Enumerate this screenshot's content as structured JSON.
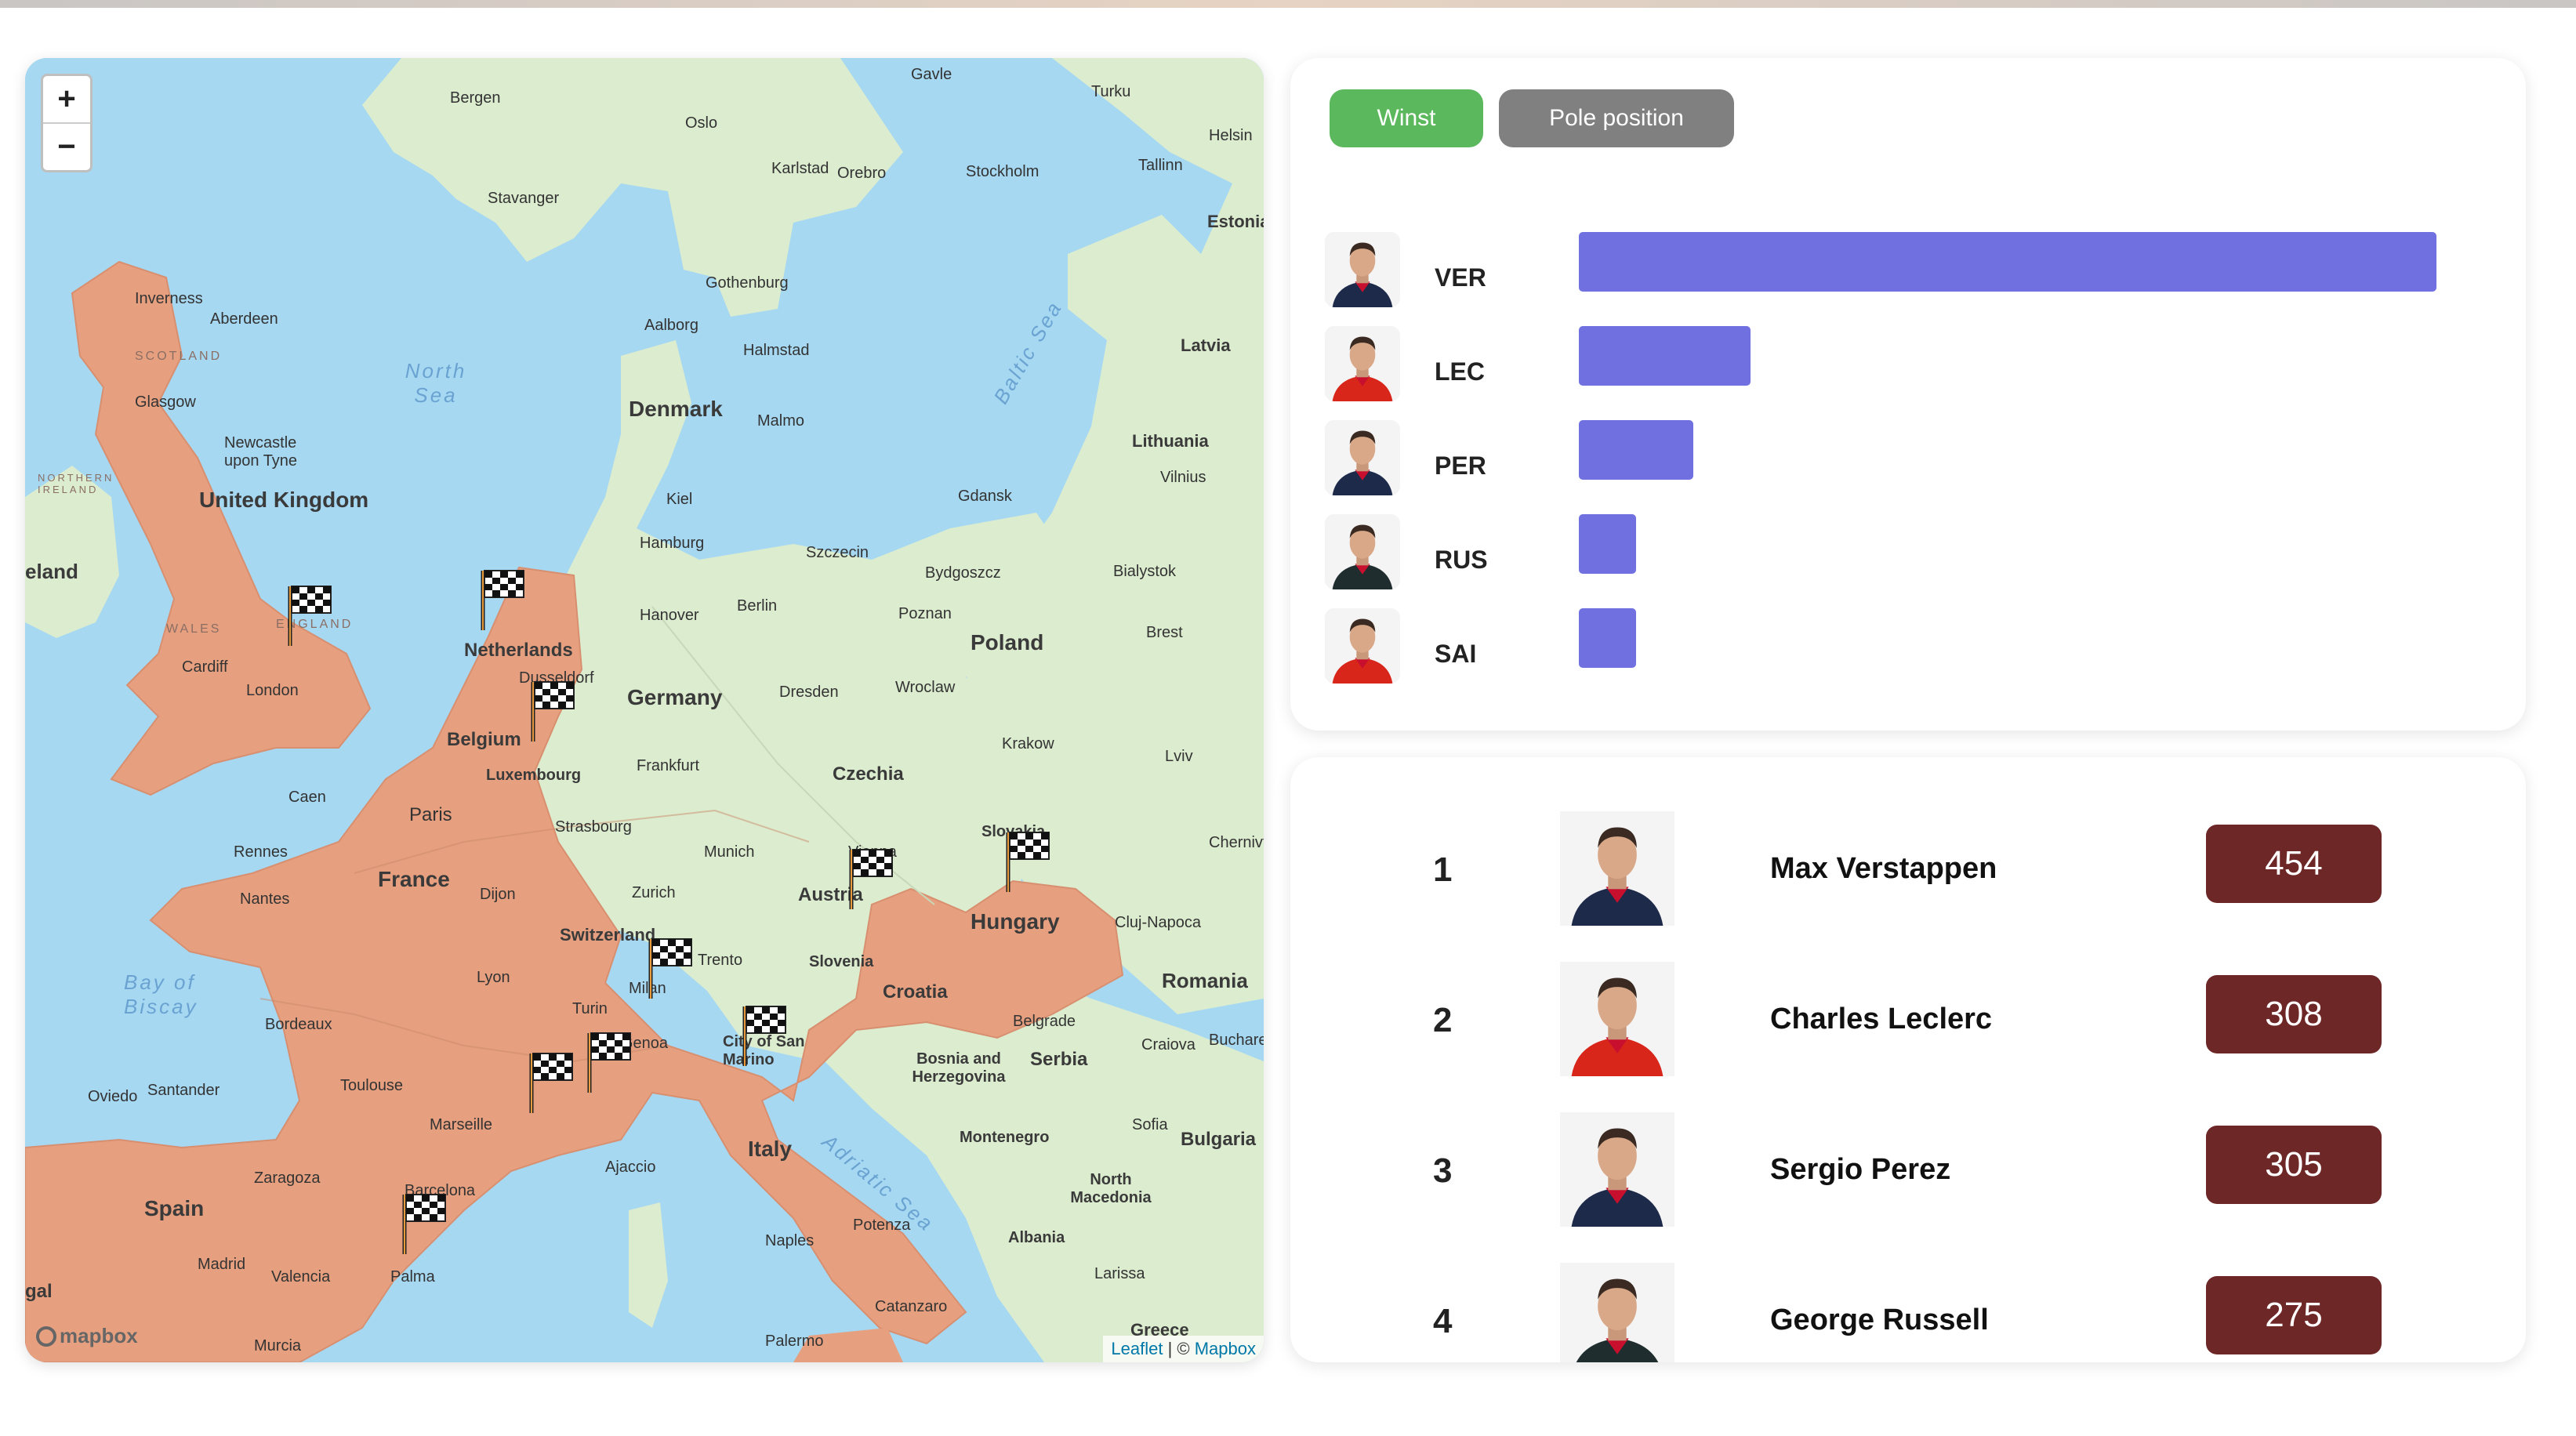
{
  "map": {
    "zoom_in": "+",
    "zoom_out": "−",
    "attribution": {
      "leaflet": "Leaflet",
      "separator": " | © ",
      "mapbox": "Mapbox"
    },
    "logo": "mapbox",
    "labels": {
      "countries": [
        "United Kingdom",
        "Netherlands",
        "Belgium",
        "Luxembourg",
        "France",
        "Germany",
        "Denmark",
        "Poland",
        "Czechia",
        "Austria",
        "Switzerland",
        "Hungary",
        "Slovakia",
        "Slovenia",
        "Croatia",
        "Italy",
        "Spain",
        "Romania",
        "Serbia",
        "Bulgaria",
        "Lithuania",
        "Latvia",
        "Estonia",
        "Bosnia and Herzegovina",
        "Montenegro",
        "North Macedonia",
        "Albania",
        "City of San Marino",
        "eland",
        "Greece",
        "gal"
      ],
      "cities": [
        "Bergen",
        "Oslo",
        "Gavle",
        "Turku",
        "Helsin",
        "Stockholm",
        "Karlstad",
        "Orebro",
        "Tallinn",
        "Stavanger",
        "Inverness",
        "Aberdeen",
        "Gothenburg",
        "Aalborg",
        "Halmstad",
        "Malmo",
        "Glasgow",
        "Newcastle upon Tyne",
        "Kiel",
        "Gdansk",
        "Vilnius",
        "Hamburg",
        "Szczecin",
        "Bydgoszcz",
        "Bialystok",
        "Hanover",
        "Berlin",
        "Poznan",
        "Brest",
        "Cardiff",
        "London",
        "Dusseldorf",
        "Dresden",
        "Wroclaw",
        "Frankfurt",
        "Krakow",
        "Lviv",
        "Caen",
        "Paris",
        "Strasbourg",
        "Munich",
        "Vienna",
        "Chernivtsi",
        "Rennes",
        "Nantes",
        "Dijon",
        "Zurich",
        "Cluj-Napoca",
        "Lyon",
        "Trento",
        "Milan",
        "Bordeaux",
        "Turin",
        "Genoa",
        "Belgrade",
        "Craiova",
        "Bucharest",
        "Toulouse",
        "Oviedo",
        "Santander",
        "Marseille",
        "Sofia",
        "Zaragoza",
        "Ajaccio",
        "Barcelona",
        "Madrid",
        "Valencia",
        "Naples",
        "Potenza",
        "Palma",
        "Larissa",
        "Catanzaro",
        "Murcia",
        "Palermo"
      ],
      "seas": [
        "North Sea",
        "Baltic Sea",
        "Bay of Biscay",
        "Adriatic Sea"
      ],
      "regions": [
        "SCOTLAND",
        "NORTHERN IRELAND",
        "WALES",
        "ENGLAND"
      ]
    }
  },
  "chart": {
    "buttons": {
      "win": "Winst",
      "pole": "Pole position"
    },
    "accent": "#7070e0"
  },
  "chart_data": {
    "type": "bar",
    "orientation": "horizontal",
    "categories": [
      "VER",
      "LEC",
      "PER",
      "RUS",
      "SAI"
    ],
    "values": [
      15,
      3,
      2,
      1,
      1
    ],
    "xlim": [
      0,
      15
    ],
    "grid": false
  },
  "standings": [
    {
      "position": "1",
      "name": "Max Verstappen",
      "points": "454",
      "team_color": "#1e2a4a"
    },
    {
      "position": "2",
      "name": "Charles Leclerc",
      "points": "308",
      "team_color": "#d8261b"
    },
    {
      "position": "3",
      "name": "Sergio Perez",
      "points": "305",
      "team_color": "#1e2a4a"
    },
    {
      "position": "4",
      "name": "George Russell",
      "points": "275",
      "team_color": "#1f2d2e"
    }
  ],
  "colors": {
    "win_button": "#5cb85c",
    "pole_button": "#808080",
    "points_badge": "#6e2727",
    "highlight_land": "#e7a07f"
  }
}
